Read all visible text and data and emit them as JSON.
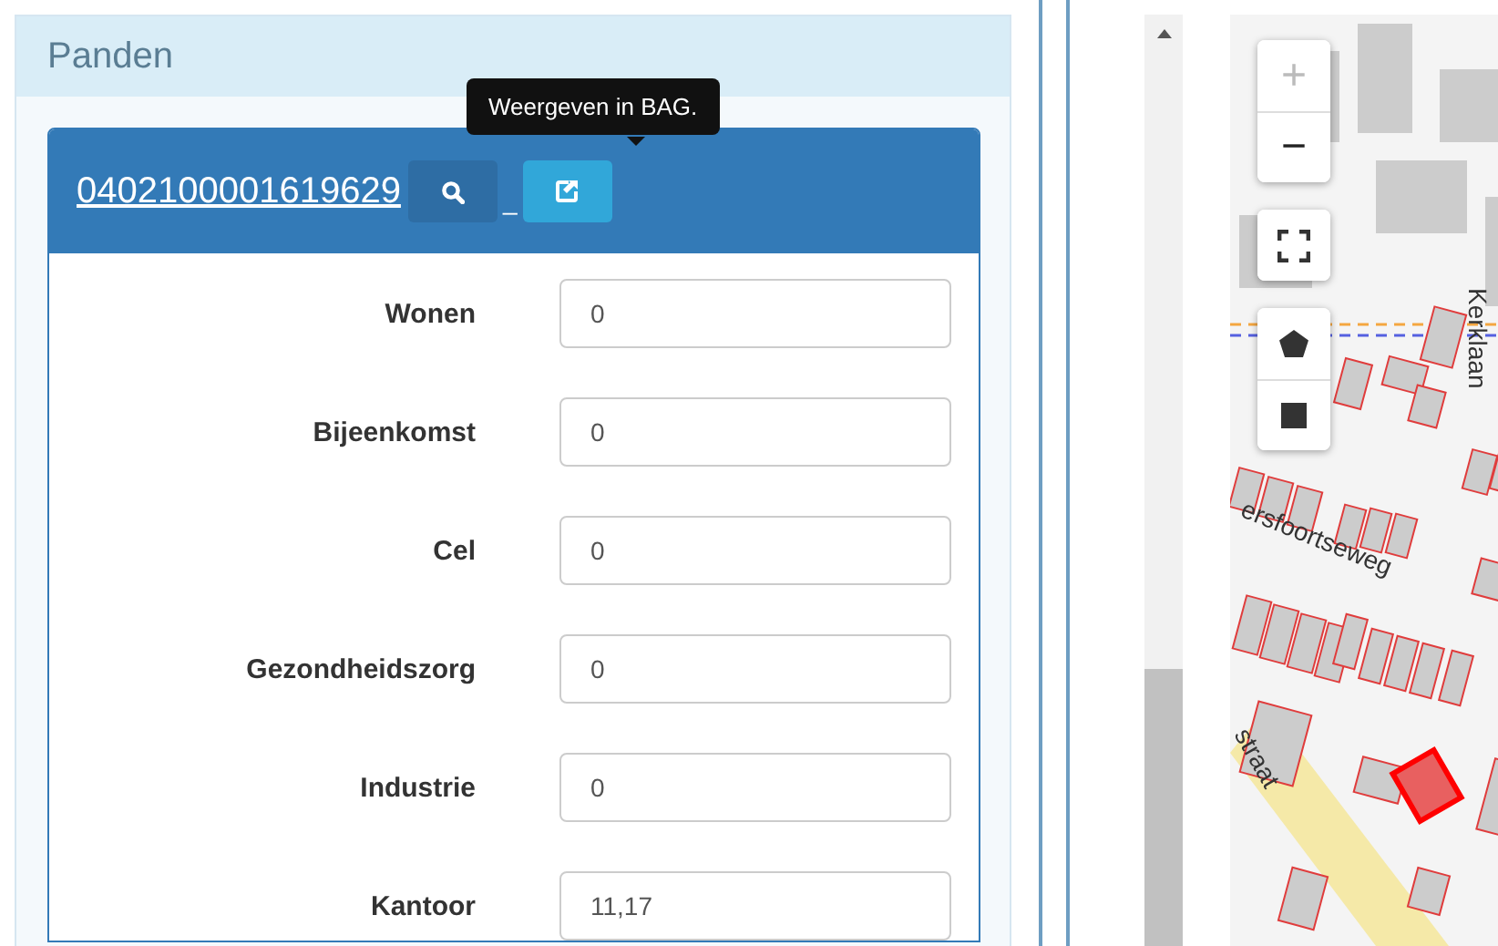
{
  "panel": {
    "title": "Panden"
  },
  "card": {
    "id_link": "0402100001619629",
    "separator": "_",
    "tooltip": "Weergeven in BAG."
  },
  "fields": [
    {
      "label": "Wonen",
      "value": "0"
    },
    {
      "label": "Bijeenkomst",
      "value": "0"
    },
    {
      "label": "Cel",
      "value": "0"
    },
    {
      "label": "Gezondheidszorg",
      "value": "0"
    },
    {
      "label": "Industrie",
      "value": "0"
    },
    {
      "label": "Kantoor",
      "value": "11,17"
    }
  ],
  "map": {
    "controls": [
      {
        "kind": "zoom-in",
        "text": "+",
        "disabled": true
      },
      {
        "kind": "zoom-out",
        "text": "−",
        "disabled": false
      },
      {
        "kind": "fullscreen"
      },
      {
        "kind": "polygon"
      },
      {
        "kind": "rectangle"
      }
    ],
    "street_labels": [
      "Kerklaan",
      "ersfoortseweg",
      "straat"
    ]
  }
}
